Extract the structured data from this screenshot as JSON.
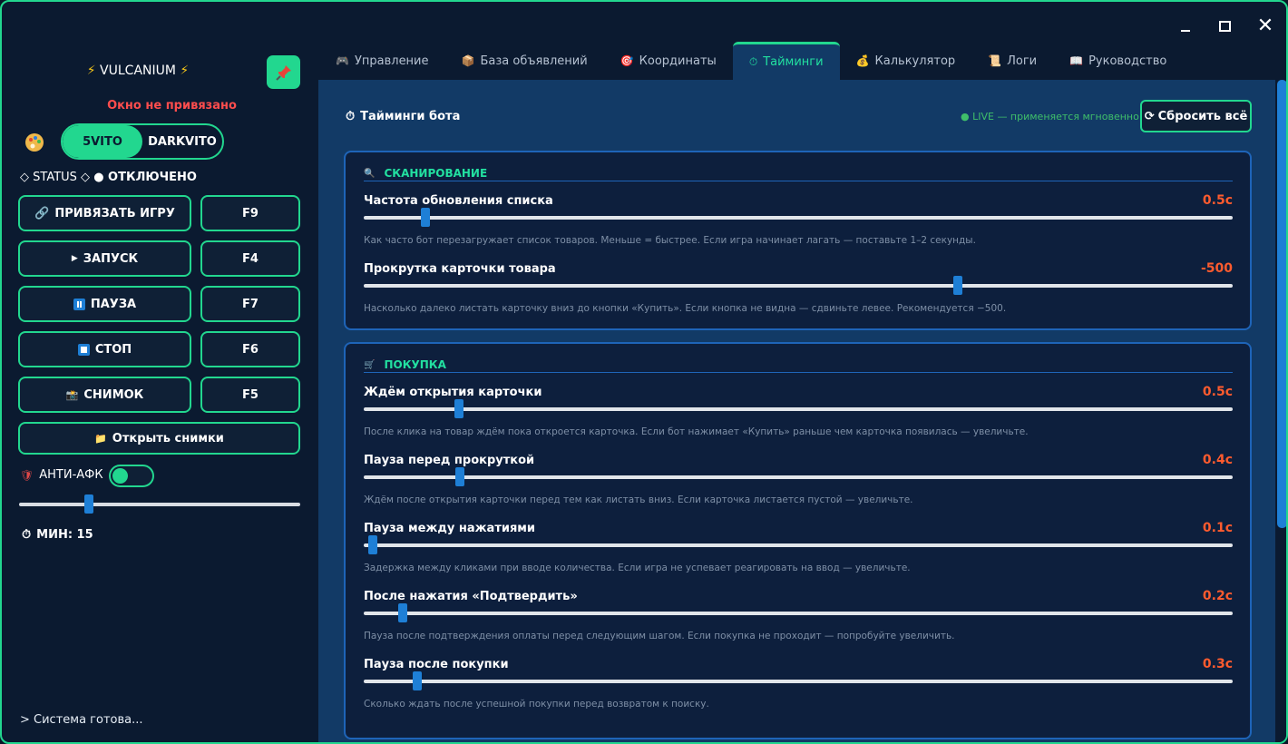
{
  "window": {
    "minimize_icon": "minimize-icon",
    "maximize_icon": "maximize-icon",
    "close_glyph": "✕"
  },
  "sidebar": {
    "brand": "VULCANIUM",
    "brand_bolt": "⚡",
    "window_status": "Окно не привязано",
    "mode_toggle": {
      "options": [
        "5VITO",
        "DARKVITO"
      ],
      "selected": "5VITO"
    },
    "status_label": "◇ STATUS ◇",
    "status_value": "● ОТКЛЮЧЕНО",
    "buttons": [
      {
        "label": "ПРИВЯЗАТЬ ИГРУ",
        "icon": "🔗",
        "hotkey": "F9"
      },
      {
        "label": "ЗАПУСК",
        "icon": "▶",
        "hotkey": "F4"
      },
      {
        "label": "ПАУЗА",
        "icon": "pause-icon",
        "hotkey": "F7"
      },
      {
        "label": "СТОП",
        "icon": "stop-icon",
        "hotkey": "F6"
      },
      {
        "label": "СНИМОК",
        "icon": "📸",
        "hotkey": "F5"
      }
    ],
    "open_snapshots": "Открыть снимки",
    "open_snapshots_icon": "📁",
    "anti_afk_icon": "🛡",
    "anti_afk_label": "АНТИ-АФК",
    "anti_afk_on": true,
    "afk_minutes_fraction": 0.24,
    "minutes_icon": "⏱",
    "minutes_label": "МИН: 15",
    "console": "> Система готова..."
  },
  "tabs": [
    {
      "label": "Управление",
      "icon": "🎮"
    },
    {
      "label": "База объявлений",
      "icon": "📦"
    },
    {
      "label": "Координаты",
      "icon": "🎯"
    },
    {
      "label": "Тайминги",
      "icon": "⏱",
      "active": true
    },
    {
      "label": "Калькулятор",
      "icon": "💰"
    },
    {
      "label": "Логи",
      "icon": "📜"
    },
    {
      "label": "Руководство",
      "icon": "📖"
    }
  ],
  "panel": {
    "title_icon": "⏱",
    "title": "Тайминги бота",
    "live": "● LIVE — применяется мгновенно",
    "reset_icon": "⟳",
    "reset_label": "Сбросить всё"
  },
  "sections": [
    {
      "title": "СКАНИРОВАНИЕ",
      "icon": "🔍",
      "rows": [
        {
          "label": "Частота обновления списка",
          "value": "0.5с",
          "fraction": 0.066,
          "hint": "Как часто бот перезагружает список товаров. Меньше = быстрее. Если игра начинает лагать — поставьте 1–2 секунды."
        },
        {
          "label": "Прокрутка карточки товара",
          "value": "-500",
          "fraction": 0.686,
          "hint": "Насколько далеко листать карточку вниз до кнопки «Купить». Если кнопка не видна — сдвиньте левее. Рекомендуется −500."
        }
      ]
    },
    {
      "title": "ПОКУПКА",
      "icon": "🛒",
      "rows": [
        {
          "label": "Ждём открытия карточки",
          "value": "0.5с",
          "fraction": 0.106,
          "hint": "После клика на товар ждём пока откроется карточка. Если бот нажимает «Купить» раньше чем карточка появилась — увеличьте."
        },
        {
          "label": "Пауза перед прокруткой",
          "value": "0.4с",
          "fraction": 0.107,
          "hint": "Ждём после открытия карточки перед тем как листать вниз. Если карточка листается пустой — увеличьте."
        },
        {
          "label": "Пауза между нажатиями",
          "value": "0.1с",
          "fraction": 0.005,
          "hint": "Задержка между кликами при вводе количества. Если игра не успевает реагировать на ввод — увеличьте."
        },
        {
          "label": "После нажатия «Подтвердить»",
          "value": "0.2с",
          "fraction": 0.04,
          "hint": "Пауза после подтверждения оплаты перед следующим шагом. Если покупка не проходит — попробуйте увеличить."
        },
        {
          "label": "Пауза после покупки",
          "value": "0.3с",
          "fraction": 0.057,
          "hint": "Сколько ждать после успешной покупки перед возвратом к поиску."
        }
      ]
    }
  ]
}
